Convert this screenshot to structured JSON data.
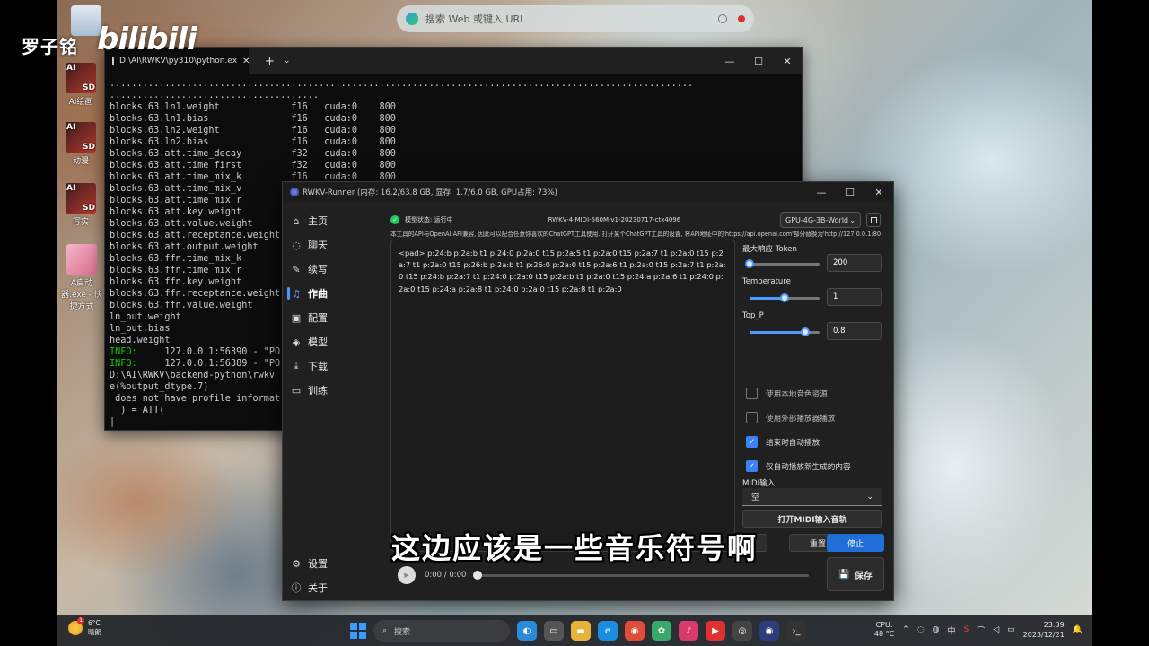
{
  "overlay": {
    "streamer": "罗子铭",
    "platform": "bilibili",
    "subtitle": "这边应该是一些音乐符号啊"
  },
  "desktop_icons": [
    {
      "label": "",
      "icon": "recycle-bin-icon"
    },
    {
      "label": "AI绘画",
      "icon": "ai-sd-icon"
    },
    {
      "label": "动漫",
      "icon": "ai-sd-icon"
    },
    {
      "label": "写实",
      "icon": "ai-sd-icon"
    },
    {
      "label": "A启动器.exe - 快捷方式",
      "icon": "launcher-icon"
    }
  ],
  "browser": {
    "placeholder": "搜索 Web 或键入 URL"
  },
  "terminal": {
    "title": "D:\\AI\\RWKV\\py310\\python.ex",
    "lines": [
      "..........................................................................................................",
      "......................................",
      "blocks.63.ln1.weight             f16   cuda:0    800",
      "blocks.63.ln1.bias               f16   cuda:0    800",
      "blocks.63.ln2.weight             f16   cuda:0    800",
      "blocks.63.ln2.bias               f16   cuda:0    800",
      "blocks.63.att.time_decay         f32   cuda:0    800",
      "blocks.63.att.time_first         f32   cuda:0    800",
      "blocks.63.att.time_mix_k         f16   cuda:0    800",
      "blocks.63.att.time_mix_v         f16   cuda:0    800",
      "blocks.63.att.time_mix_r         f16   cuda:0    800",
      "blocks.63.att.key.weight",
      "blocks.63.att.value.weight",
      "blocks.63.att.receptance.weight",
      "blocks.63.att.output.weight",
      "blocks.63.ffn.time_mix_k",
      "blocks.63.ffn.time_mix_r",
      "blocks.63.ffn.key.weight",
      "blocks.63.ffn.receptance.weight",
      "blocks.63.ffn.value.weight",
      "ln_out.weight",
      "ln_out.bias",
      "head.weight"
    ],
    "info_lines": [
      {
        "tag": "INFO:",
        "text": "     127.0.0.1:56390 - \"PO"
      },
      {
        "tag": "INFO:",
        "text": "     127.0.0.1:56389 - \"PO"
      }
    ],
    "tail_lines": [
      "D:\\AI\\RWKV\\backend-python\\rwkv_",
      "e(%output_dtype.7)",
      " does not have profile informat",
      "  ) = ATT("
    ]
  },
  "rwkv": {
    "title": "RWKV-Runner (内存: 16.2/63.8 GB, 显存: 1.7/6.0 GB, GPU占用: 73%)",
    "nav": [
      {
        "label": "主页",
        "icon": "home-icon",
        "glyph": "⌂"
      },
      {
        "label": "聊天",
        "icon": "chat-icon",
        "glyph": "◌"
      },
      {
        "label": "续写",
        "icon": "edit-icon",
        "glyph": "✎"
      },
      {
        "label": "作曲",
        "icon": "music-icon",
        "glyph": "♫"
      },
      {
        "label": "配置",
        "icon": "config-icon",
        "glyph": "▣"
      },
      {
        "label": "模型",
        "icon": "model-icon",
        "glyph": "◈"
      },
      {
        "label": "下载",
        "icon": "download-icon",
        "glyph": "⤓"
      },
      {
        "label": "训练",
        "icon": "train-icon",
        "glyph": "▭"
      }
    ],
    "nav_bottom": [
      {
        "label": "设置",
        "icon": "settings-icon",
        "glyph": "⚙"
      },
      {
        "label": "关于",
        "icon": "about-icon",
        "glyph": "ⓘ"
      }
    ],
    "status_label": "模型状态: 运行中",
    "model_name": "RWKV-4-MIDI-560M-v1-20230717-ctx4096",
    "gpu_select": "GPU-4G-3B-World",
    "notice": "本工具的API与OpenAI API兼容, 因此可以配合任意你喜欢的ChatGPT工具使用. 打开某个ChatGPT工具的设置, 将API地址中的'https://api.openai.com'部分替换为'http://127.0.0.1:8000'.",
    "composition_text": "<pad> p:24:b p:2a:b t1 p:24:0 p:2a:0 t15 p:2a:5 t1 p:2a:0 t15 p:2a:7 t1 p:2a:0 t15 p:2a:7 t1 p:2a:0 t15 p:26:b p:2a:b t1 p:26:0 p:2a:0 t15 p:2a:6 t1 p:2a:0 t15 p:2a:7 t1 p:2a:0 t15 p:24:b p:2a:7 t1 p:24:0 p:2a:0 t15 p:2a:b t1 p:2a:0 t15 p:24:a p:2a:6 t1 p:24:0 p:2a:0 t15 p:24:a p:2a:8 t1 p:24:0 p:2a:0 t15 p:2a:8 t1 p:2a:0",
    "params": [
      {
        "label": "最大响应 Token",
        "value": "200",
        "level": 0.0
      },
      {
        "label": "Temperature",
        "value": "1",
        "level": 0.5
      },
      {
        "label": "Top_P",
        "value": "0.8",
        "level": 0.8
      }
    ],
    "options": [
      {
        "label": "使用本地音色资源",
        "checked": false
      },
      {
        "label": "使用外部播放器播放",
        "checked": false
      },
      {
        "label": "结束时自动播放",
        "checked": true
      },
      {
        "label": "仅自动播放新生成的内容",
        "checked": true
      }
    ],
    "midi_label": "MIDI输入",
    "midi_value": "空",
    "midi_button": "打开MIDI输入音轨",
    "reset_button": "重置",
    "stop_button": "停止",
    "time": "0:00 / 0:00",
    "save_button": "保存"
  },
  "taskbar": {
    "temp": "6°C",
    "weather": "晴朗",
    "weather_badge": "1",
    "search": "搜索",
    "cpu_label": "CPU:",
    "cpu_temp": "48 °C",
    "ime": "中",
    "time": "23:39",
    "date": "2023/12/21"
  },
  "colors": {
    "accent": "#1f6fd6",
    "status_ok": "#22c55e",
    "terminal_info": "#16c60c"
  }
}
